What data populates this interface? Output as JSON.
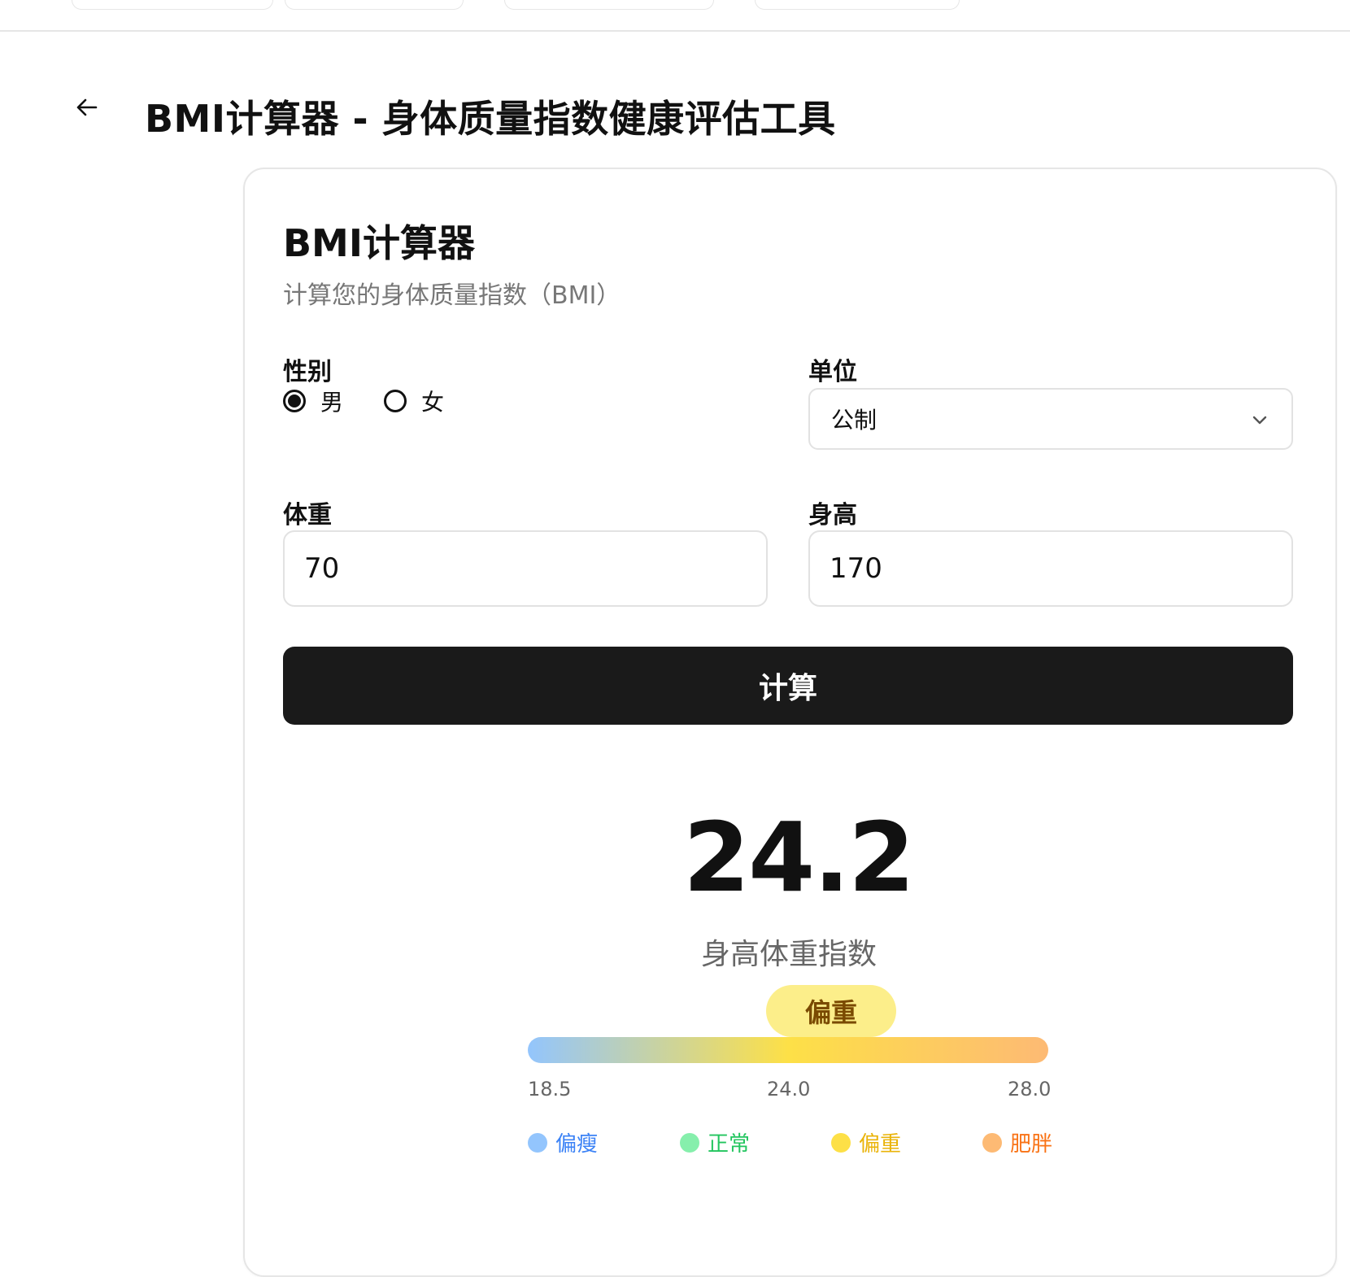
{
  "header": {
    "title": "BMI计算器 - 身体质量指数健康评估工具"
  },
  "card": {
    "title": "BMI计算器",
    "subtitle": "计算您的身体质量指数（BMI）"
  },
  "form": {
    "gender": {
      "label": "性别",
      "options": [
        {
          "label": "男",
          "selected": true
        },
        {
          "label": "女",
          "selected": false
        }
      ]
    },
    "unit": {
      "label": "单位",
      "selected": "公制"
    },
    "weight": {
      "label": "体重",
      "value": "70"
    },
    "height": {
      "label": "身高",
      "value": "170"
    },
    "calculate_label": "计算"
  },
  "result": {
    "bmi": "24.2",
    "caption": "身高体重指数",
    "status": "偏重",
    "scale": {
      "ticks": [
        "18.5",
        "24.0",
        "28.0"
      ],
      "gradient_colors": [
        "#93c5fd",
        "#fde047",
        "#fdba74"
      ]
    },
    "legend": [
      {
        "label": "偏瘦",
        "dot_color": "#93c5fd",
        "text_color": "#3b82f6"
      },
      {
        "label": "正常",
        "dot_color": "#86efac",
        "text_color": "#22c55e"
      },
      {
        "label": "偏重",
        "dot_color": "#fde047",
        "text_color": "#eab308"
      },
      {
        "label": "肥胖",
        "dot_color": "#fdba74",
        "text_color": "#f97316"
      }
    ]
  },
  "colors": {
    "primary_button": "#1a1a1a",
    "status_badge_bg": "#fcee8a",
    "status_badge_text": "#7a4a00"
  }
}
